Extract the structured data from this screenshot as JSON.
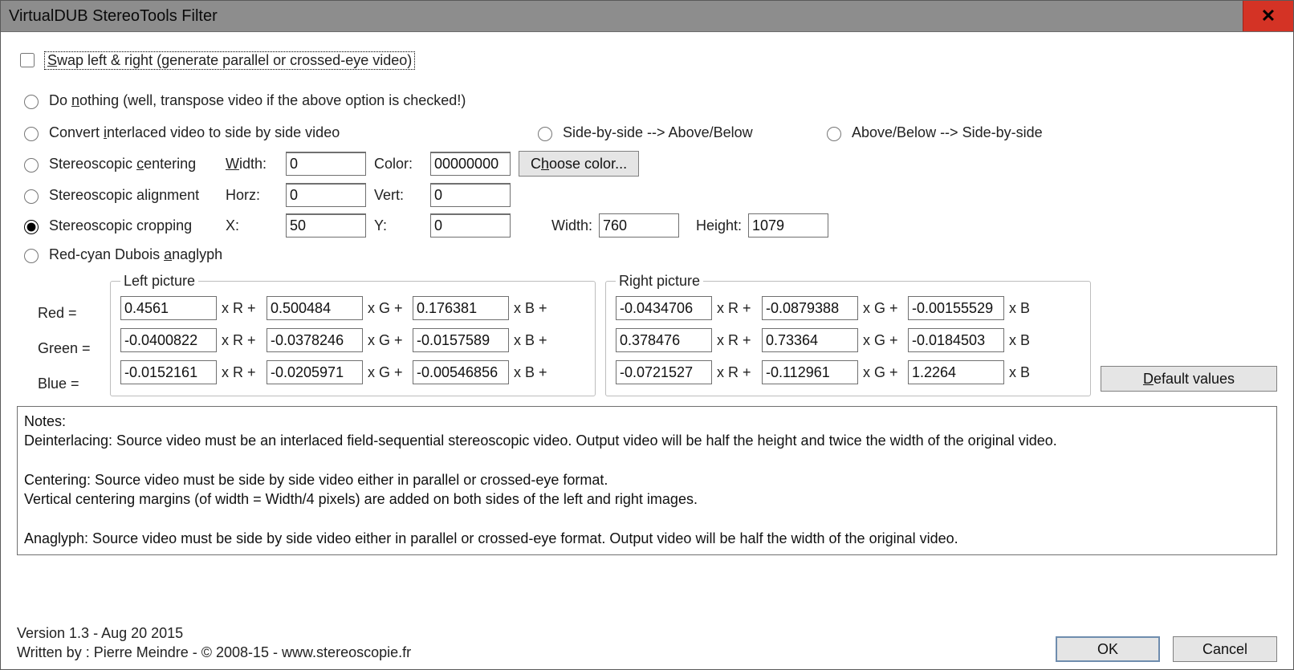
{
  "window": {
    "title": "VirtualDUB StereoTools Filter"
  },
  "options": {
    "swap": {
      "label_pre": "S",
      "label_rest": "wap left & right (generate parallel or crossed-eye video)",
      "checked": false
    },
    "radio": [
      {
        "id": "do-nothing",
        "pre": "Do ",
        "u": "n",
        "rest": "othing (well, transpose video if the above option is checked!)"
      },
      {
        "id": "convert-interlaced",
        "pre": "Convert ",
        "u": "i",
        "rest": "nterlaced video to side by side video"
      },
      {
        "id": "sbs-to-ab",
        "pre": "Side-by-side --> Above/Below",
        "u": "",
        "rest": ""
      },
      {
        "id": "ab-to-sbs",
        "pre": "Above/Below --> Side-by-side",
        "u": "",
        "rest": ""
      },
      {
        "id": "centering",
        "pre": "Stereoscopic ",
        "u": "c",
        "rest": "entering"
      },
      {
        "id": "alignment",
        "pre": "Stereoscopic alignment",
        "u": "",
        "rest": ""
      },
      {
        "id": "cropping",
        "pre": "Stereoscopic cropping",
        "u": "",
        "rest": ""
      },
      {
        "id": "anaglyph",
        "pre": "Red-cyan Dubois ",
        "u": "a",
        "rest": "naglyph"
      }
    ],
    "selected_radio": "cropping"
  },
  "centering": {
    "width_label_pre": "",
    "width_u": "W",
    "width_label_rest": "idth:",
    "width_value": "0",
    "color_label": "Color:",
    "color_value": "00000000",
    "choose_pre": "C",
    "choose_u": "h",
    "choose_rest": "oose color..."
  },
  "alignment": {
    "horz_label": "Horz:",
    "horz_value": "0",
    "vert_label": "Vert:",
    "vert_value": "0"
  },
  "cropping": {
    "x_label": "X:",
    "x_value": "50",
    "y_label": "Y:",
    "y_value": "0",
    "w_label": "Width:",
    "w_value": "760",
    "h_label": "Height:",
    "h_value": "1079"
  },
  "matrix_labels": {
    "red": "Red =",
    "green": "Green =",
    "blue": "Blue =",
    "xr": "x R +",
    "xg": "x G +",
    "xb": "x B",
    "xbp": "x B +"
  },
  "left": {
    "title": "Left picture",
    "r": [
      "0.4561",
      "0.500484",
      "0.176381"
    ],
    "g": [
      "-0.0400822",
      "-0.0378246",
      "-0.0157589"
    ],
    "b": [
      "-0.0152161",
      "-0.0205971",
      "-0.00546856"
    ]
  },
  "right": {
    "title": "Right picture",
    "r": [
      "-0.0434706",
      "-0.0879388",
      "-0.00155529"
    ],
    "g": [
      "0.378476",
      "0.73364",
      "-0.0184503"
    ],
    "b": [
      "-0.0721527",
      "-0.112961",
      "1.2264"
    ]
  },
  "default_btn": {
    "pre": "",
    "u": "D",
    "rest": "efault values"
  },
  "notes": {
    "title": "Notes:",
    "l1": "Deinterlacing: Source video must be an interlaced field-sequential stereoscopic video. Output video will be half the height and twice the width of the original video.",
    "l2": "Centering: Source video must be side by side video either in parallel or crossed-eye format.",
    "l3": "Vertical centering margins (of width = Width/4 pixels) are added on both sides of the left and right images.",
    "l4": "Anaglyph: Source video must be side by side video either in parallel or crossed-eye format. Output video will be half the width of the original video."
  },
  "footer": {
    "version": "Version 1.3 - Aug 20 2015",
    "author": "Written by : Pierre Meindre - © 2008-15 - www.stereoscopie.fr",
    "ok": "OK",
    "cancel": "Cancel"
  }
}
